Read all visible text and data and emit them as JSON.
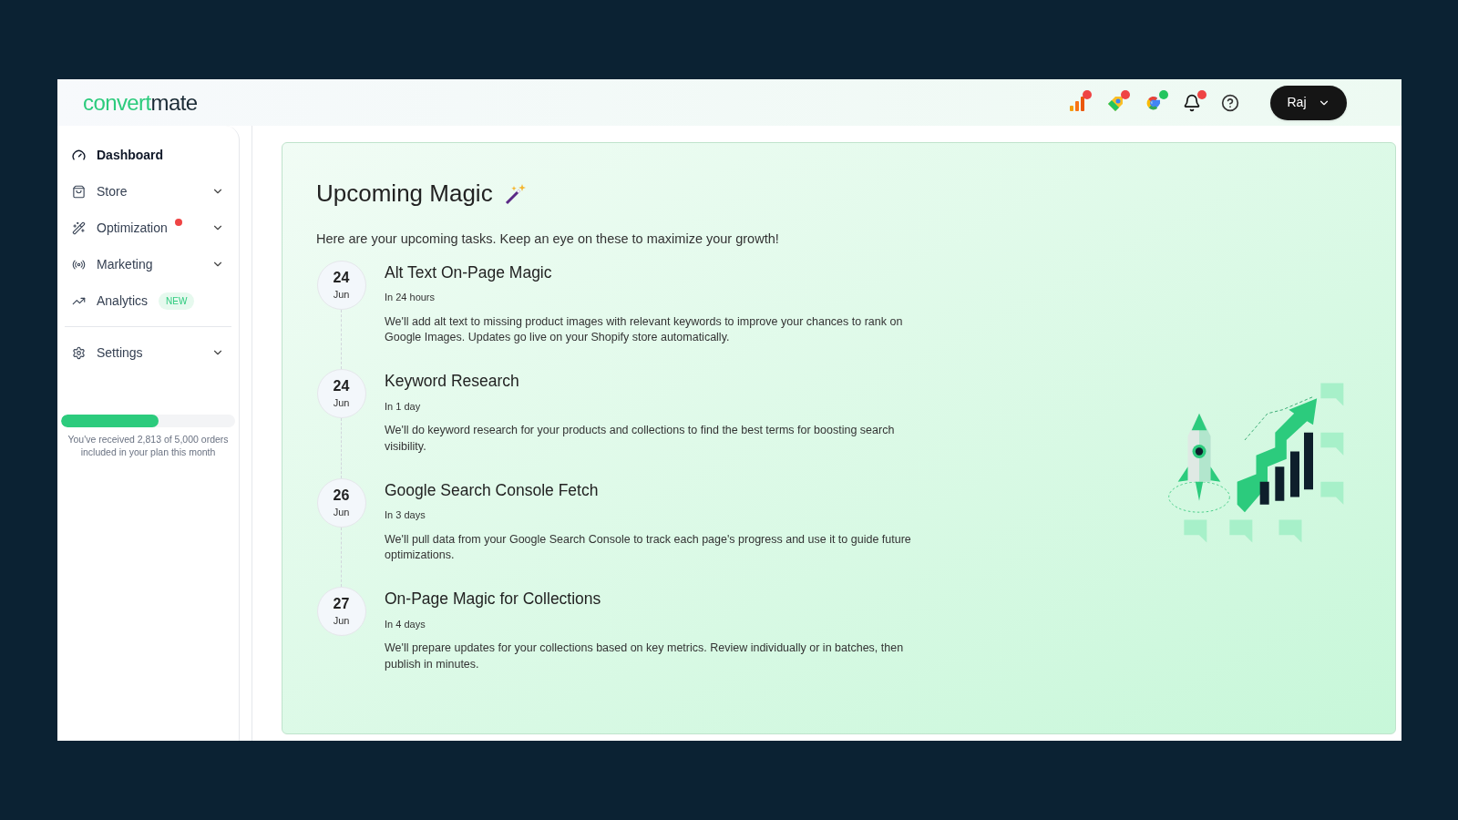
{
  "logo": {
    "part1": "convert",
    "part2": "mate"
  },
  "header_icons": [
    {
      "kind": "bars",
      "color": "#ef4444"
    },
    {
      "kind": "tag",
      "color": "#ef4444"
    },
    {
      "kind": "google",
      "color": "#22c55e"
    },
    {
      "kind": "bell",
      "color": "#ef4444"
    },
    {
      "kind": "help"
    }
  ],
  "user_menu": {
    "label": "Raj"
  },
  "sidebar": {
    "items": [
      {
        "kind": "gauge",
        "label": "Dashboard",
        "selected": true,
        "expandable": false
      },
      {
        "kind": "bag",
        "label": "Store",
        "selected": false,
        "expandable": true
      },
      {
        "kind": "wand",
        "label": "Optimization",
        "selected": false,
        "expandable": true,
        "color": "#ef4444"
      },
      {
        "kind": "signal",
        "label": "Marketing",
        "selected": false,
        "expandable": true
      },
      {
        "kind": "chart",
        "label": "Analytics",
        "selected": false,
        "expandable": false,
        "badge": "NEW"
      },
      {
        "kind": "gear",
        "label": "Settings",
        "selected": false,
        "expandable": true
      }
    ],
    "usage": {
      "level": 0.5626,
      "text": "You've received 2,813 of 5,000 orders included in your plan this month"
    }
  },
  "main": {
    "title": "Upcoming Magic",
    "subtitle": "Here are your upcoming tasks. Keep an eye on these to maximize your growth!",
    "tasks": [
      {
        "day": "24",
        "month": "Jun",
        "title": "Alt Text On-Page Magic",
        "due": "In 24 hours",
        "description": "We'll add alt text to missing product images with relevant keywords to improve your chances to rank on Google Images. Updates go live on your Shopify store automatically."
      },
      {
        "day": "24",
        "month": "Jun",
        "title": "Keyword Research",
        "due": "In 1 day",
        "description": "We'll do keyword research for your products and collections to find the best terms for boosting search visibility."
      },
      {
        "day": "26",
        "month": "Jun",
        "title": "Google Search Console Fetch",
        "due": "In 3 days",
        "description": "We'll pull data from your Google Search Console to track each page's progress and use it to guide future optimizations."
      },
      {
        "day": "27",
        "month": "Jun",
        "title": "On-Page Magic for Collections",
        "due": "In 4 days",
        "description": "We'll prepare updates for your collections based on key metrics. Review individually or in batches, then publish in minutes."
      }
    ]
  }
}
